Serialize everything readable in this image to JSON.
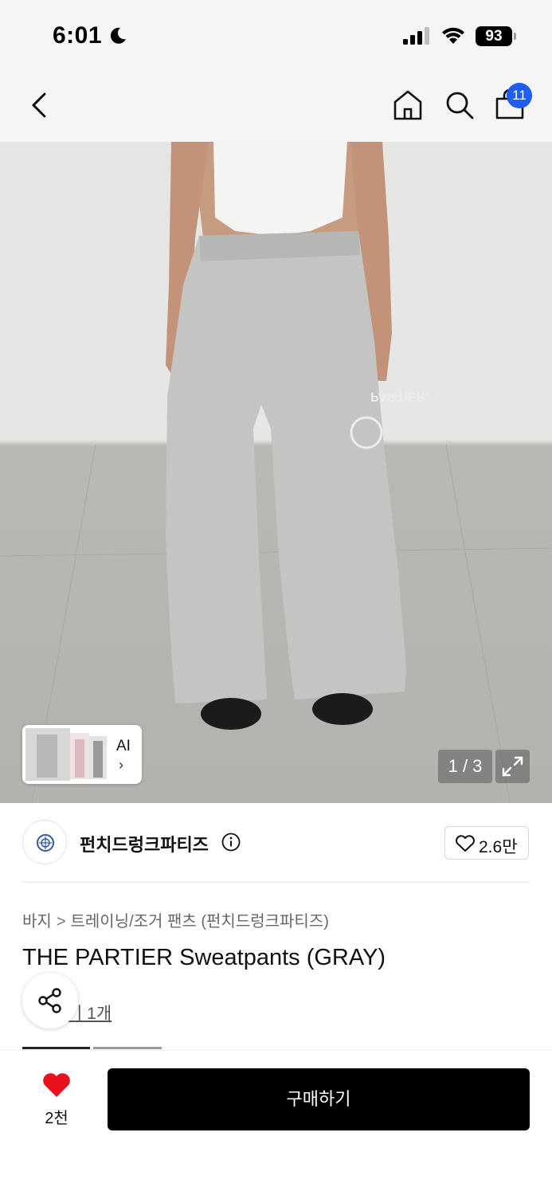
{
  "status_bar": {
    "time": "6:01",
    "battery": "93"
  },
  "header": {
    "cart_count": "11"
  },
  "gallery": {
    "ai_label": "AI",
    "ai_chevron": "›",
    "pager": "1 / 3"
  },
  "brand": {
    "name": "펀치드렁크파티즈",
    "likes": "2.6만"
  },
  "breadcrumb": {
    "category": "바지",
    "separator": ">",
    "subcategory": "트레이닝/조거 팬츠 (펀치드렁크파티즈)"
  },
  "product": {
    "title": "THE PARTIER Sweatpants (GRAY)",
    "review_link": "후기 1개",
    "review_link_visible": "기 1개"
  },
  "bottom_bar": {
    "wish_count": "2천",
    "buy_label": "구매하기"
  },
  "colors": {
    "accent_blue": "#1f5ef0",
    "heart_red": "#e8121f",
    "buy_button": "#000000"
  },
  "icons": [
    "moon-icon",
    "signal-icon",
    "wifi-icon",
    "back-chevron-icon",
    "home-icon",
    "search-icon",
    "shopping-bag-icon",
    "expand-icon",
    "info-icon",
    "heart-outline-icon",
    "share-icon",
    "heart-filled-icon"
  ]
}
